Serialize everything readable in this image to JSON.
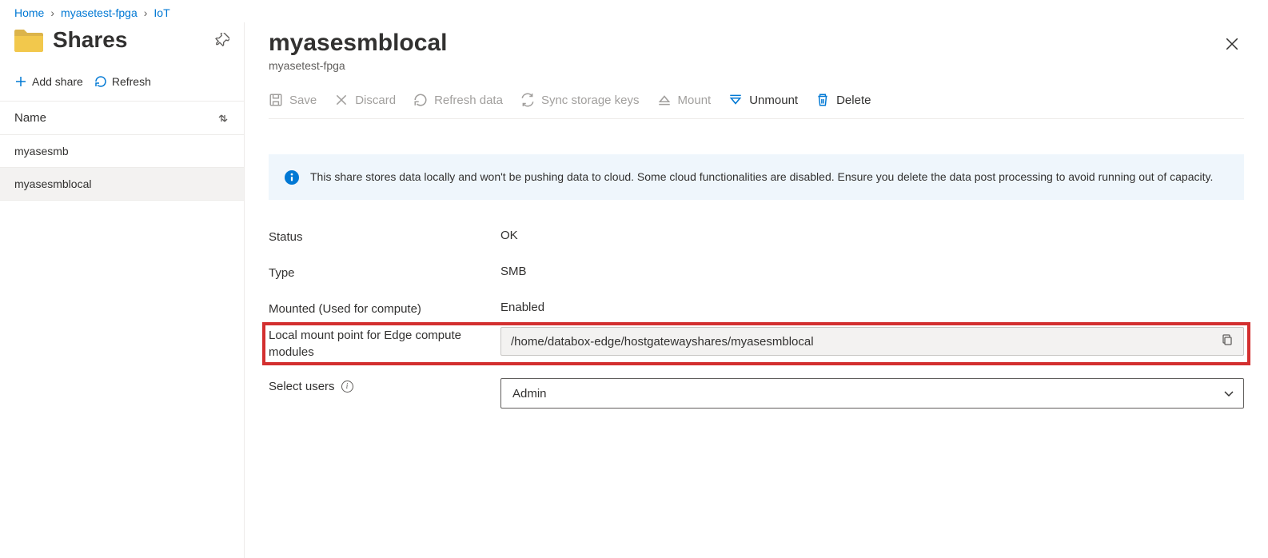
{
  "breadcrumb": {
    "home": "Home",
    "resource": "myasetest-fpga",
    "section": "IoT"
  },
  "left": {
    "title": "Shares",
    "addShare": "Add share",
    "refresh": "Refresh",
    "columnName": "Name",
    "items": [
      {
        "name": "myasesmb"
      },
      {
        "name": "myasesmblocal"
      }
    ]
  },
  "panel": {
    "title": "myasesmblocal",
    "subtitle": "myasetest-fpga"
  },
  "commands": {
    "save": "Save",
    "discard": "Discard",
    "refreshData": "Refresh data",
    "syncStorage": "Sync storage keys",
    "mount": "Mount",
    "unmount": "Unmount",
    "delete": "Delete"
  },
  "banner": {
    "text": "This share stores data locally and won't be pushing data to cloud. Some cloud functionalities are disabled. Ensure you delete the data post processing to avoid running out of capacity."
  },
  "props": {
    "statusLabel": "Status",
    "statusValue": "OK",
    "typeLabel": "Type",
    "typeValue": "SMB",
    "mountedLabel": "Mounted (Used for compute)",
    "mountedValue": "Enabled",
    "localMountLabel": "Local mount point for Edge compute modules",
    "localMountValue": "/home/databox-edge/hostgatewayshares/myasesmblocal",
    "selectUsersLabel": "Select users",
    "selectUsersValue": "Admin"
  }
}
